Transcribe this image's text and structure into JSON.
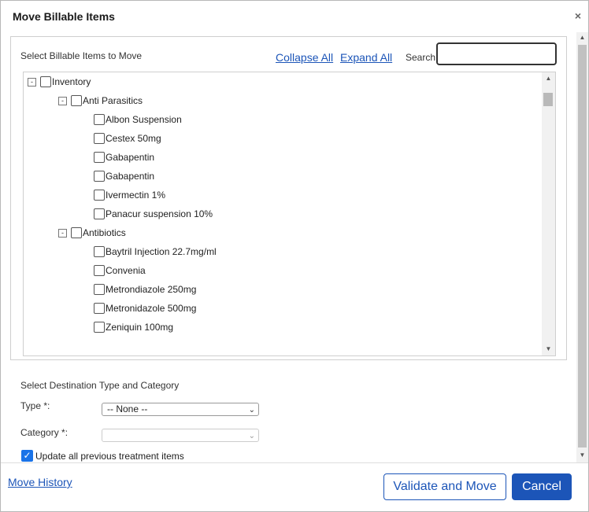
{
  "dialog": {
    "title": "Move Billable Items",
    "close_glyph": "×"
  },
  "items_panel": {
    "heading": "Select Billable Items to Move",
    "collapse_all": "Collapse All",
    "expand_all": "Expand All",
    "search_label": "Search",
    "search_value": ""
  },
  "tree": {
    "root": {
      "label": "Inventory",
      "expander": "-"
    },
    "groups": [
      {
        "label": "Anti Parasitics",
        "expander": "-",
        "items": [
          "Albon Suspension",
          "Cestex 50mg",
          "Gabapentin",
          "Gabapentin",
          "Ivermectin 1%",
          "Panacur suspension 10%"
        ]
      },
      {
        "label": "Antibiotics",
        "expander": "-",
        "items": [
          "Baytril Injection 22.7mg/ml",
          "Convenia",
          "Metrondiazole 250mg",
          "Metronidazole 500mg",
          "Zeniquin 100mg"
        ]
      }
    ]
  },
  "destination": {
    "heading": "Select Destination Type and Category",
    "type_label": "Type *:",
    "type_value": "-- None --",
    "category_label": "Category *:",
    "category_value": "",
    "update_label": "Update all previous treatment items",
    "update_checked": true
  },
  "footer": {
    "move_history": "Move History",
    "validate_label": "Validate and Move",
    "cancel_label": "Cancel"
  },
  "colors": {
    "link": "#1c55b8",
    "primary_button": "#1c55b8",
    "checkbox_checked": "#1a73e8"
  }
}
